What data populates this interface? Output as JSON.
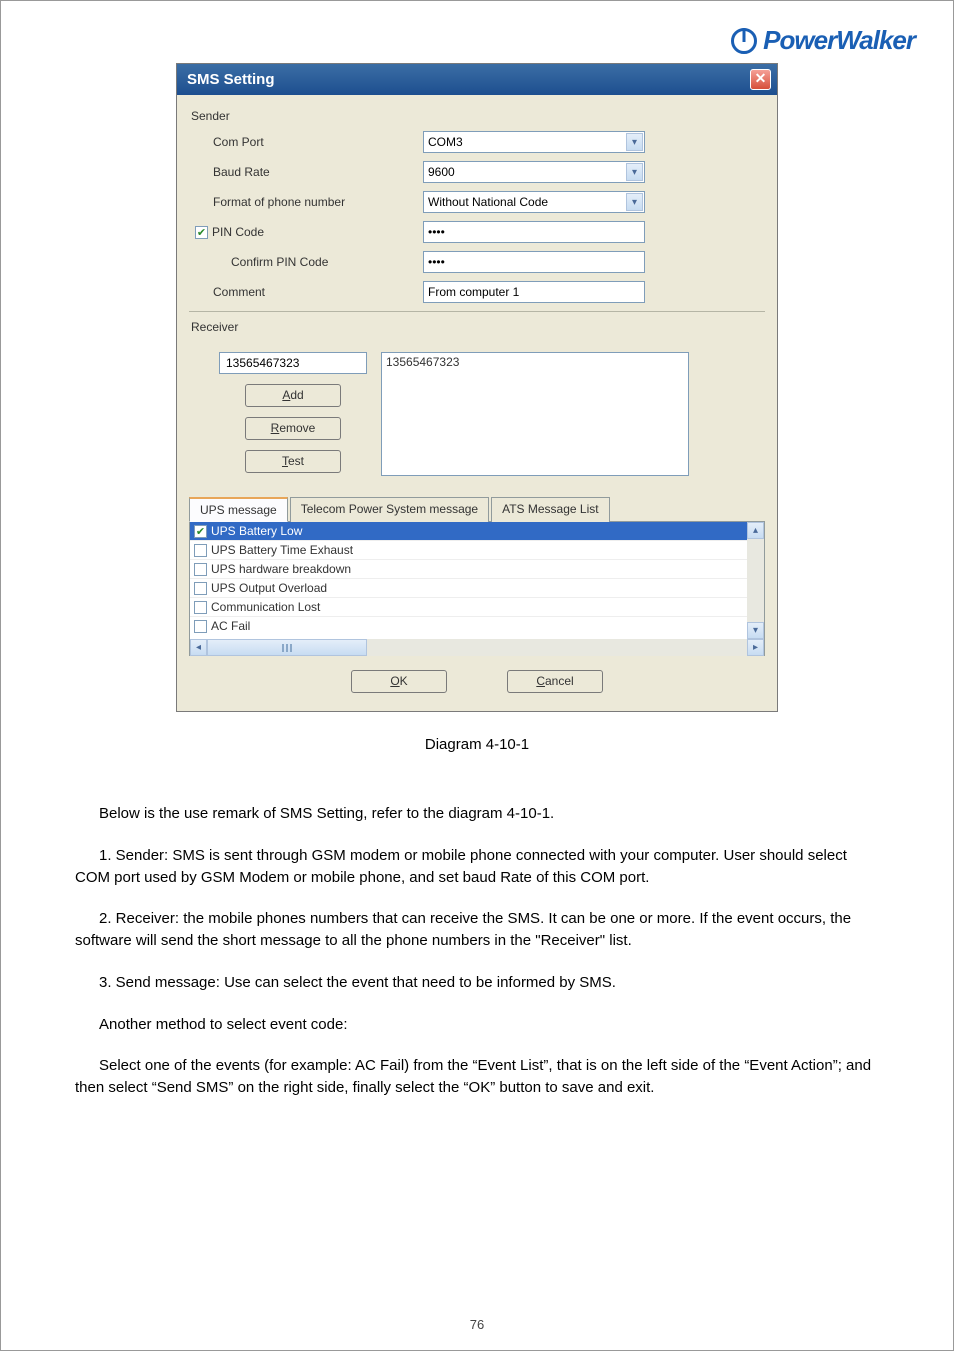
{
  "brand": "PowerWalker",
  "dialog": {
    "title": "SMS Setting",
    "sender": {
      "heading": "Sender",
      "labels": {
        "com_port": "Com Port",
        "baud_rate": "Baud Rate",
        "format": "Format of phone number",
        "pin": "PIN Code",
        "confirm_pin": "Confirm PIN Code",
        "comment": "Comment"
      },
      "values": {
        "com_port": "COM3",
        "baud_rate": "9600",
        "format": "Without National Code",
        "pin": "••••",
        "confirm_pin": "••••",
        "comment": "From computer 1"
      }
    },
    "receiver": {
      "heading": "Receiver",
      "phone_input": "13565467323",
      "add": "Add",
      "remove": "Remove",
      "test": "Test",
      "list": [
        "13565467323"
      ]
    },
    "tabs": {
      "ups": "UPS message",
      "telecom": "Telecom Power System message",
      "ats": "ATS Message List"
    },
    "messages": [
      {
        "label": "UPS Battery Low",
        "checked": true,
        "selected": true
      },
      {
        "label": "UPS Battery Time Exhaust",
        "checked": false,
        "selected": false
      },
      {
        "label": "UPS hardware breakdown",
        "checked": false,
        "selected": false
      },
      {
        "label": "UPS Output Overload",
        "checked": false,
        "selected": false
      },
      {
        "label": "Communication Lost",
        "checked": false,
        "selected": false
      },
      {
        "label": "AC Fail",
        "checked": false,
        "selected": false
      }
    ],
    "ok": "OK",
    "cancel": "Cancel"
  },
  "caption": "Diagram 4-10-1",
  "body": {
    "p1": "Below is the use remark of SMS Setting, refer to the diagram 4-10-1.",
    "p2": "1. Sender: SMS is sent through GSM modem or mobile phone connected with your computer. User should select COM port used by GSM Modem or mobile phone, and set baud Rate of this COM port.",
    "p3": "2. Receiver: the mobile phones numbers that can receive the SMS. It can be one or more. If the event occurs, the software will send the short message to all the phone numbers in the \"Receiver\" list.",
    "p4": "3. Send message: Use can select the event that need to be informed by SMS.",
    "p5": "Another method to select event code:",
    "p6": "Select one of the events (for example: AC Fail) from the “Event List”, that is on the left side of the “Event Action”; and then select “Send SMS” on the right side, finally select the “OK” button to save and exit."
  },
  "page_number": "76"
}
